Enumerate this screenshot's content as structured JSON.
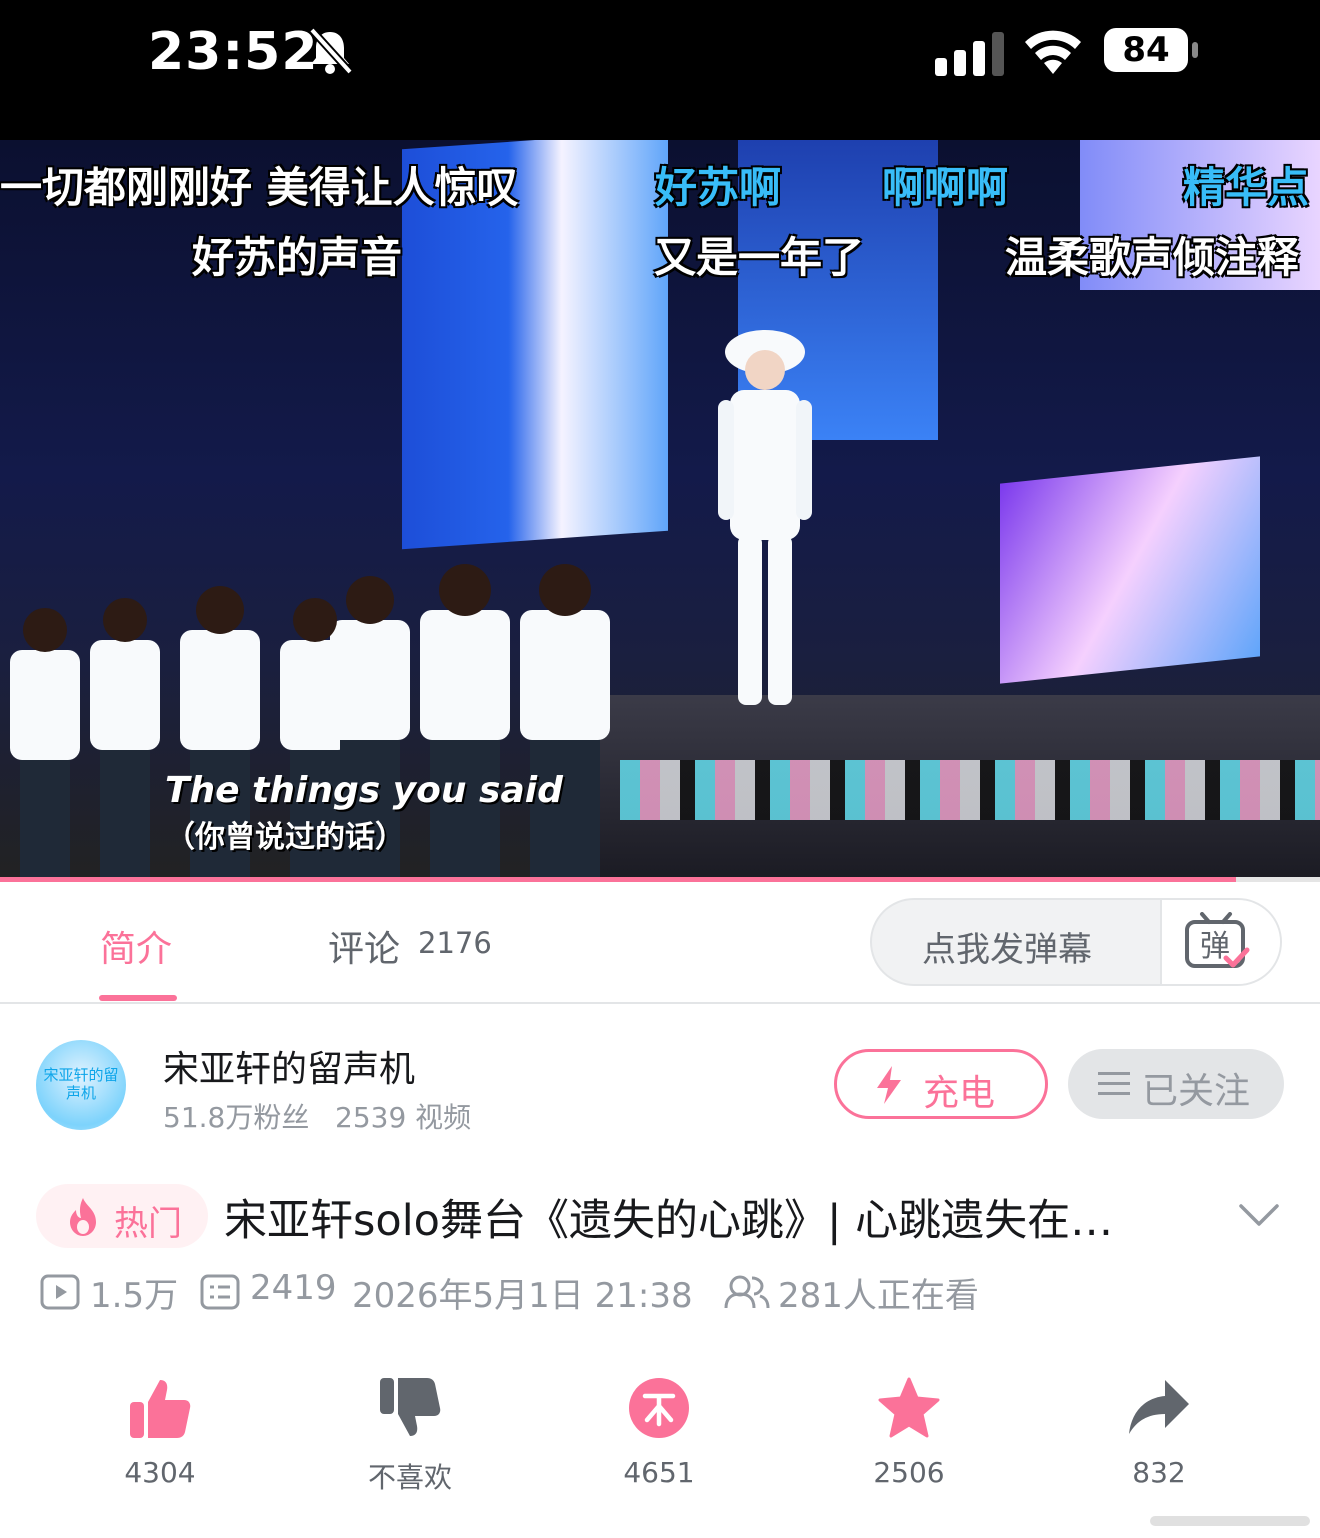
{
  "status_bar": {
    "time": "23:52",
    "battery": "84",
    "icons": [
      "bell-slash-icon",
      "signal-icon",
      "wifi-icon",
      "battery-icon"
    ]
  },
  "video": {
    "danmaku": [
      {
        "text": "一切都刚刚好 美得让人惊叹",
        "color": "white"
      },
      {
        "text": "好苏啊",
        "color": "blue"
      },
      {
        "text": "啊啊啊",
        "color": "blue"
      },
      {
        "text": "精华点",
        "color": "blue"
      },
      {
        "text": "好苏的声音",
        "color": "white"
      },
      {
        "text": "又是一年了",
        "color": "white"
      },
      {
        "text": "温柔歌声倾注释",
        "color": "white"
      }
    ],
    "subtitle_en": "The things you said",
    "subtitle_cn": "（你曾说过的话）",
    "progress": 0.936
  },
  "tabs": {
    "intro": "简介",
    "comments": "评论",
    "comments_count": "2176",
    "danmaku_placeholder": "点我发弹幕",
    "danmaku_button": "弹"
  },
  "uploader": {
    "name": "宋亚轩的留声机",
    "avatar_text": "宋亚轩的留声机",
    "fans": "51.8万粉丝",
    "videos": "2539 视频",
    "charge": "充电",
    "follow": "已关注"
  },
  "video_info": {
    "hot_label": "热门",
    "title": "宋亚轩solo舞台《遗失的心跳》| 心跳遗失在…",
    "views": "1.5万",
    "danmaku_count": "2419",
    "date": "2026年5月1日 21:38",
    "watching": "281人正在看"
  },
  "actions": {
    "like": "4304",
    "dislike": "不喜欢",
    "coin": "4651",
    "favorite": "2506",
    "share": "832"
  },
  "colors": {
    "accent": "#fb7299",
    "gray_text": "#9499a0",
    "dark_text": "#18191c"
  }
}
